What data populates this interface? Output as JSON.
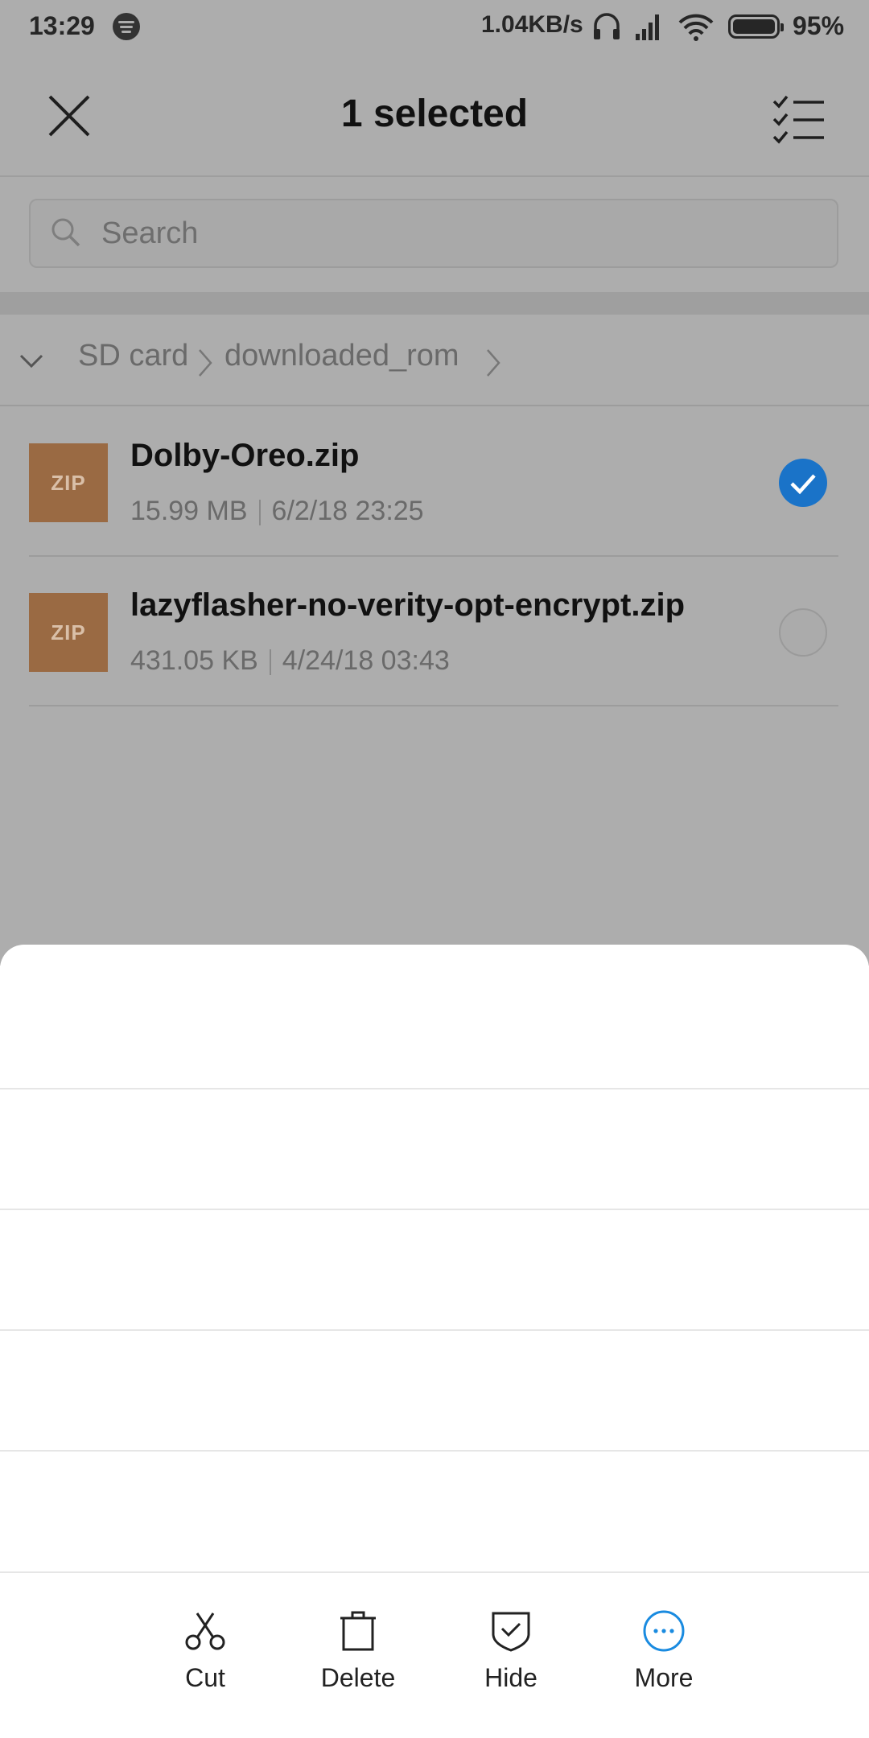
{
  "status_bar": {
    "time": "13:29",
    "network_speed": "1.04KB/s",
    "battery_percent": "95%",
    "icons": [
      "spotify-icon",
      "headset-icon",
      "signal-icon",
      "wifi-icon",
      "battery-icon"
    ]
  },
  "header": {
    "title": "1 selected",
    "close_icon": "close-icon",
    "select_all_icon": "checklist-icon"
  },
  "search": {
    "placeholder": "Search"
  },
  "breadcrumb": {
    "items": [
      "SD card",
      "downloaded_rom"
    ]
  },
  "files": [
    {
      "thumb_label": "ZIP",
      "name": "Dolby-Oreo.zip",
      "size": "15.99 MB",
      "date": "6/2/18 23:25",
      "selected": true
    },
    {
      "thumb_label": "ZIP",
      "name": "lazyflasher-no-verity-opt-encrypt.zip",
      "size": "431.05 KB",
      "date": "4/24/18 03:43",
      "selected": false
    }
  ],
  "actions": [
    {
      "label": "Cut",
      "icon": "scissors-icon"
    },
    {
      "label": "Delete",
      "icon": "trash-icon"
    },
    {
      "label": "Hide",
      "icon": "shield-check-icon"
    },
    {
      "label": "More",
      "icon": "more-icon"
    }
  ],
  "colors": {
    "accent": "#1a73c8",
    "zip_thumb": "#9a6a43",
    "scrim": "#adadad"
  }
}
